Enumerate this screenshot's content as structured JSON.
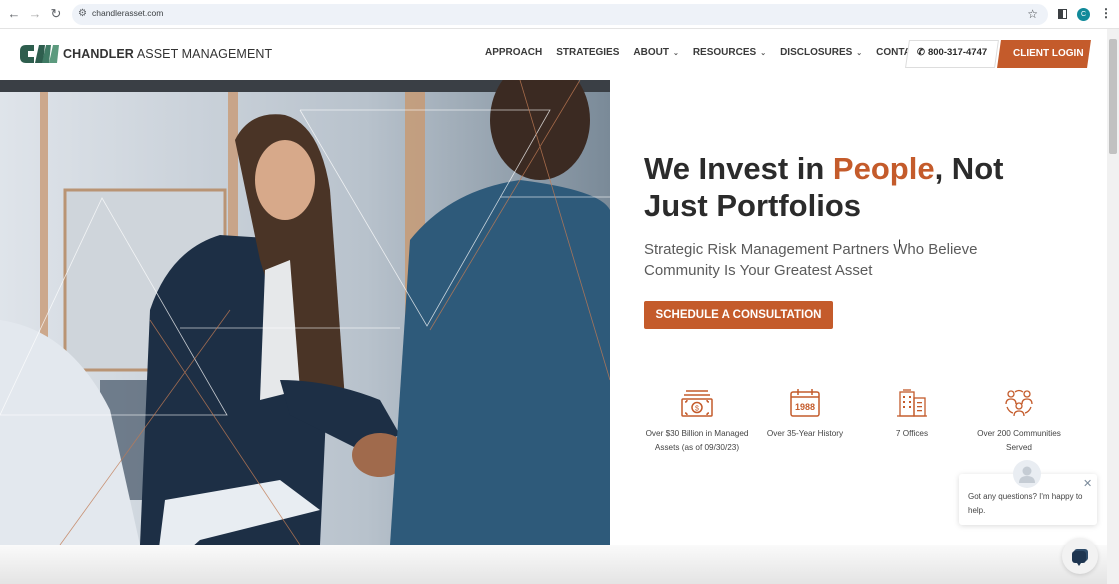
{
  "browser": {
    "url": "chandlerasset.com",
    "profile_initial": "C",
    "back_icon": "←",
    "forward_icon": "→",
    "reload_icon": "↻",
    "site_info_icon": "⚙",
    "bookmark_icon": "☆",
    "menu_icon": "⋮"
  },
  "header": {
    "logo_bold": "CHANDLER",
    "logo_rest": " ASSET MANAGEMENT",
    "nav": [
      {
        "label": "APPROACH",
        "has_dropdown": false
      },
      {
        "label": "STRATEGIES",
        "has_dropdown": false
      },
      {
        "label": "ABOUT",
        "has_dropdown": true
      },
      {
        "label": "RESOURCES",
        "has_dropdown": true
      },
      {
        "label": "DISCLOSURES",
        "has_dropdown": true
      },
      {
        "label": "CONTACT",
        "has_dropdown": false
      }
    ],
    "chevron": "⌄",
    "phone_icon": "✆",
    "phone": "800-317-4747",
    "login_label": "CLIENT LOGIN"
  },
  "hero": {
    "title_part1": "We Invest in ",
    "title_accent": "People",
    "title_part2": ", Not Just Portfolios",
    "subtitle": "Strategic Risk Management Partners Who Believe Community Is Your Greatest Asset",
    "cta_label": "SCHEDULE A CONSULTATION",
    "image_alt": "Businesswoman shaking hands with a client in an office"
  },
  "stats": [
    {
      "icon": "money-icon",
      "label": "Over $30 Billion in Managed Assets (as of 09/30/23)"
    },
    {
      "icon": "calendar-icon",
      "calendar_year": "1988",
      "label": "Over 35-Year History"
    },
    {
      "icon": "building-icon",
      "label": "7 Offices"
    },
    {
      "icon": "community-icon",
      "label": "Over 200 Communities Served"
    }
  ],
  "chat": {
    "message": "Got any questions? I'm happy to help.",
    "close_icon": "✕"
  },
  "colors": {
    "accent": "#c45b2b",
    "logo_green": "#2e5e4e",
    "text_dark": "#2b2b2b"
  }
}
